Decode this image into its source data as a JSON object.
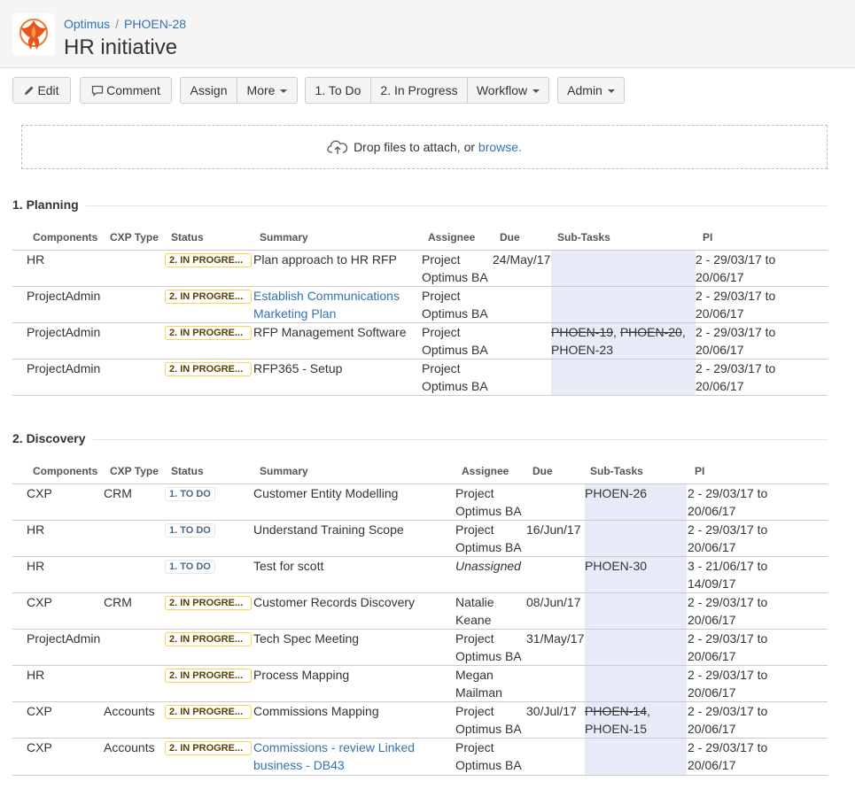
{
  "breadcrumb": {
    "project": "Optimus",
    "issue": "PHOEN-28",
    "separator": "/"
  },
  "page_title": "HR initiative",
  "toolbar": {
    "edit": "Edit",
    "comment": "Comment",
    "assign": "Assign",
    "more": "More",
    "todo": "1. To Do",
    "in_progress": "2. In Progress",
    "workflow": "Workflow",
    "admin": "Admin"
  },
  "dropzone": {
    "text": "Drop files to attach, or",
    "link": "browse."
  },
  "colors": {
    "accent": "#3572b0",
    "subtask_bg": "#e6ebf7",
    "in_progress_border": "#ffd351"
  },
  "sections": [
    {
      "title": "1. Planning",
      "headers": [
        "Components",
        "CXP Type",
        "Status",
        "Summary",
        "Assignee",
        "Due",
        "Sub-Tasks",
        "PI"
      ],
      "rows": [
        {
          "component": "HR",
          "cxp": "",
          "status": "2. IN PROGRE...",
          "summary": "Plan approach to HR RFP",
          "assignee_1": "Project",
          "assignee_2": "Optimus BA",
          "due": "24/May/17",
          "sub_1": "",
          "sub_2": "",
          "pi_1": "2 - 29/03/17 to",
          "pi_2": "20/06/17"
        },
        {
          "component": "ProjectAdmin",
          "cxp": "",
          "status": "2. IN PROGRE...",
          "summary": "Establish Communications",
          "summary_2": "Marketing Plan",
          "assignee_1": "Project",
          "assignee_2": "Optimus BA",
          "due": "",
          "pi_1": "2 - 29/03/17 to",
          "pi_2": "20/06/17"
        },
        {
          "component": "ProjectAdmin",
          "cxp": "",
          "status": "2. IN PROGRE...",
          "summary": "RFP Management Software",
          "assignee_1": "Project",
          "assignee_2": "Optimus BA",
          "due": "",
          "sub_a": "PHOEN-19",
          "sub_b": "PHOEN-20",
          "sub_c": "PHOEN-23",
          "pi_1": "2 - 29/03/17 to",
          "pi_2": "20/06/17"
        },
        {
          "component": "ProjectAdmin",
          "cxp": "",
          "status": "2. IN PROGRE...",
          "summary": "RFP365 - Setup",
          "assignee_1": "Project",
          "assignee_2": "Optimus BA",
          "due": "",
          "pi_1": "2 - 29/03/17 to",
          "pi_2": "20/06/17"
        }
      ]
    },
    {
      "title": "2. Discovery",
      "headers": [
        "Components",
        "CXP Type",
        "Status",
        "Summary",
        "Assignee",
        "Due",
        "Sub-Tasks",
        "PI"
      ],
      "rows": [
        {
          "component": "CXP",
          "cxp": "CRM",
          "status": "1. TO DO",
          "summary": "Customer Entity Modelling",
          "assignee_1": "Project",
          "assignee_2": "Optimus BA",
          "due": "",
          "sub": "PHOEN-26",
          "pi_1": "2 - 29/03/17 to",
          "pi_2": "20/06/17"
        },
        {
          "component": "HR",
          "cxp": "",
          "status": "1. TO DO",
          "summary": "Understand Training Scope",
          "assignee_1": "Project",
          "assignee_2": "Optimus BA",
          "due": "16/Jun/17",
          "sub": "",
          "pi_1": "2 - 29/03/17 to",
          "pi_2": "20/06/17"
        },
        {
          "component": "HR",
          "cxp": "",
          "status": "1. TO DO",
          "summary": "Test for scott",
          "assignee_1": "Unassigned",
          "assignee_2": "",
          "due": "",
          "sub": "PHOEN-30",
          "pi_1": "3 - 21/06/17 to",
          "pi_2": "14/09/17"
        },
        {
          "component": "CXP",
          "cxp": "CRM",
          "status": "2. IN PROGRE...",
          "summary": "Customer Records Discovery",
          "assignee_1": "Natalie",
          "assignee_2": "Keane",
          "due": "08/Jun/17",
          "sub": "",
          "pi_1": "2 - 29/03/17 to",
          "pi_2": "20/06/17"
        },
        {
          "component": "ProjectAdmin",
          "cxp": "",
          "status": "2. IN PROGRE...",
          "summary": "Tech Spec Meeting",
          "assignee_1": "Project",
          "assignee_2": "Optimus BA",
          "due": "31/May/17",
          "sub": "",
          "pi_1": "2 - 29/03/17 to",
          "pi_2": "20/06/17"
        },
        {
          "component": "HR",
          "cxp": "",
          "status": "2. IN PROGRE...",
          "summary": "Process Mapping",
          "assignee_1": "Megan",
          "assignee_2": "Mailman",
          "due": "",
          "sub": "",
          "pi_1": "2 - 29/03/17 to",
          "pi_2": "20/06/17"
        },
        {
          "component": "CXP",
          "cxp": "Accounts",
          "status": "2. IN PROGRE...",
          "summary": "Commissions Mapping",
          "assignee_1": "Project",
          "assignee_2": "Optimus BA",
          "due": "30/Jul/17",
          "sub_a": "PHOEN-14",
          "sub_b": "PHOEN-15",
          "pi_1": "2 - 29/03/17 to",
          "pi_2": "20/06/17"
        },
        {
          "component": "CXP",
          "cxp": "Accounts",
          "status": "2. IN PROGRE...",
          "summary": "Commissions - review Linked",
          "summary_2": "business - DB43",
          "assignee_1": "Project",
          "assignee_2": "Optimus BA",
          "due": "",
          "sub": "",
          "pi_1": "2 - 29/03/17 to",
          "pi_2": "20/06/17"
        }
      ]
    }
  ]
}
